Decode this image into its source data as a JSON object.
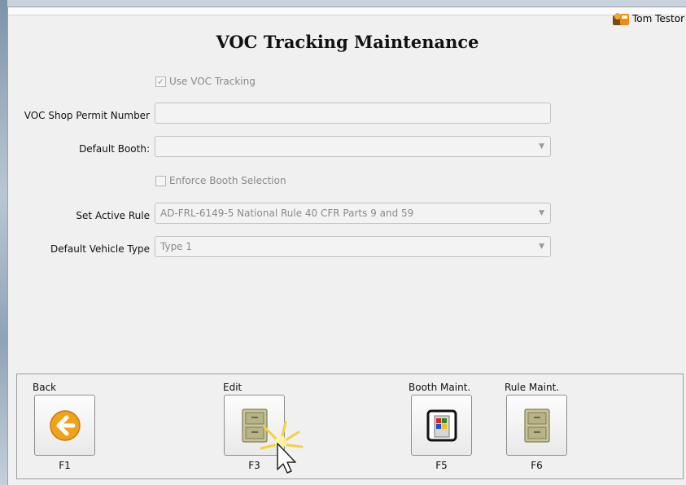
{
  "header": {
    "user_name": "Tom Testor"
  },
  "page": {
    "title": "VOC Tracking Maintenance"
  },
  "form": {
    "use_voc_tracking": {
      "label": "Use VOC Tracking",
      "checked": true
    },
    "shop_permit": {
      "label": "VOC Shop Permit Number",
      "value": ""
    },
    "default_booth": {
      "label": "Default Booth:",
      "value": ""
    },
    "enforce_booth": {
      "label": "Enforce Booth Selection",
      "checked": false
    },
    "active_rule": {
      "label": "Set Active Rule",
      "value": "AD-FRL-6149-5 National Rule 40 CFR Parts 9 and 59"
    },
    "vehicle_type": {
      "label": "Default Vehicle Type",
      "value": "Type 1"
    }
  },
  "function_keys": [
    {
      "label": "Back",
      "key": "F1",
      "icon": "back-arrow-icon"
    },
    {
      "label": "Edit",
      "key": "F3",
      "icon": "file-cabinet-icon"
    },
    {
      "label": "Booth Maint.",
      "key": "F5",
      "icon": "booth-icon"
    },
    {
      "label": "Rule Maint.",
      "key": "F6",
      "icon": "file-cabinet-icon"
    }
  ],
  "colors": {
    "back_icon": "#f0a21c",
    "cabinet": "#c9c59a"
  }
}
